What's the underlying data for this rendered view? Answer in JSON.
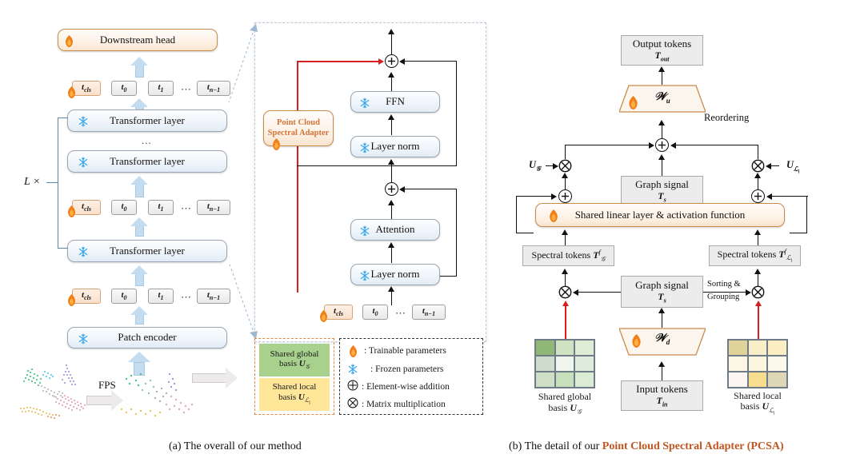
{
  "figure": {
    "caption_a_prefix": "(a) The overall of our method",
    "caption_b_prefix": "(b) The detail of our ",
    "caption_b_accent": "Point Cloud Spectral Adapter (PCSA)"
  },
  "colors": {
    "accent_orange": "#c05621",
    "adapter_text": "#d2743a",
    "red_path": "#d61f1f",
    "blue_arrow": "#c4dcf0",
    "green_basis": "#a9d18e",
    "yellow_basis": "#ffe699",
    "box_gray": "#ececec"
  },
  "panel_a": {
    "downstream_head": "Downstream head",
    "transformer_layer": "Transformer layer",
    "patch_encoder": "Patch encoder",
    "vertical_dots": "...",
    "loop_label": "L ×",
    "fps_label": "FPS",
    "tokens": [
      {
        "cls": "t",
        "sub": "cls"
      },
      {
        "cls": "t",
        "sub": "0"
      },
      {
        "cls": "t",
        "sub": "1"
      },
      {
        "cls": "t",
        "sub": "n−1"
      }
    ],
    "token_ellipsis": "⋯",
    "inset": {
      "adapter_line1": "Point Cloud",
      "adapter_line2": "Spectral Adapter",
      "ffn": "FFN",
      "layer_norm": "Layer norm",
      "attention": "Attention",
      "add_symbol": "⊕"
    },
    "basis_legend": {
      "global_line1": "Shared global",
      "global_line2_prefix": "basis ",
      "global_line2_sym": "U",
      "global_line2_sub": "𝒢",
      "local_line1": "Shared local",
      "local_line2_prefix": "basis ",
      "local_line2_sym": "U",
      "local_line2_sub": "ℒᵢ"
    },
    "symbol_legend": [
      {
        "icon": "flame-icon",
        "text": ": Trainable parameters"
      },
      {
        "icon": "snowflake-icon",
        "text": ": Frozen parameters"
      },
      {
        "icon": "plus-circle-icon",
        "text": ": Element-wise addition"
      },
      {
        "icon": "times-circle-icon",
        "text": ": Matrix multiplication"
      }
    ]
  },
  "panel_b": {
    "output_tokens_l1": "Output tokens",
    "output_tokens_l2_sym": "T",
    "output_tokens_l2_sub": "out",
    "w_up_sym": "𝒲",
    "w_up_sub": "u",
    "w_down_sym": "𝒲",
    "w_down_sub": "d",
    "reordering": "Reordering",
    "graph_signal_l1": "Graph signal",
    "graph_signal_sym": "T",
    "graph_signal_sub": "s",
    "shared_linear": "Shared linear layer & activation function",
    "spectral_tokens_left_prefix": "Spectral tokens ",
    "spectral_tokens_left_sym": "T",
    "spectral_tokens_left_sup": "f",
    "spectral_tokens_left_sub": "𝒢",
    "spectral_tokens_right_prefix": "Spectral tokens ",
    "spectral_tokens_right_sym": "T",
    "spectral_tokens_right_sup": "f",
    "spectral_tokens_right_sub": "ℒᵢ",
    "sorting_l1": "Sorting &",
    "sorting_l2": "Grouping",
    "input_tokens_l1": "Input tokens",
    "input_tokens_sym": "T",
    "input_tokens_sub": "in",
    "u_global_sym": "U",
    "u_global_sub": "𝒢",
    "u_local_sym": "U",
    "u_local_sub": "ℒᵢ",
    "shared_global_l1": "Shared global",
    "shared_global_l2_prefix": "basis ",
    "shared_global_l2_sym": "U",
    "shared_global_l2_sub": "𝒢",
    "shared_local_l1": "Shared local",
    "shared_local_l2_prefix": "basis ",
    "shared_local_l2_sym": "U",
    "shared_local_l2_sub": "ℒᵢ",
    "global_matrix_cells": [
      "#8fb877",
      "#cfe2c2",
      "#dfecd6",
      "#cfdccb",
      "#f0f6ee",
      "#e0ecdc",
      "#cfdfc6",
      "#c8dfbb",
      "#dcebd4"
    ],
    "local_matrix_cells": [
      "#e0d39a",
      "#f8eec8",
      "#fbeec2",
      "#fbf7e4",
      "#fdf6de",
      "#fbf8ec",
      "#fbf6f2",
      "#f7dd8e",
      "#ded7b6"
    ]
  }
}
